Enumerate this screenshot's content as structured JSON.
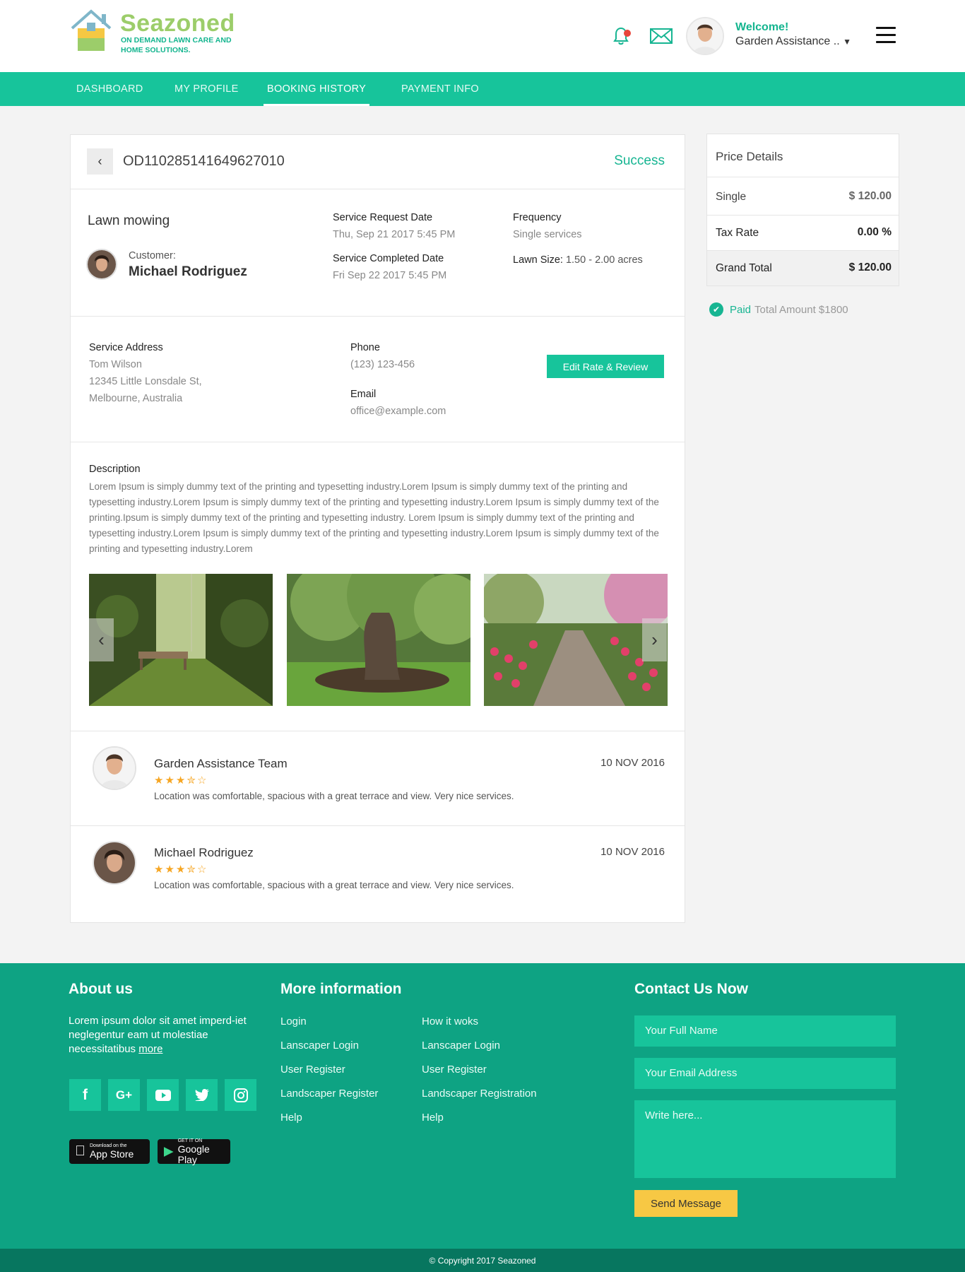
{
  "brand": {
    "name": "Seazoned",
    "tagline": "ON DEMAND LAWN CARE AND HOME SOLUTIONS.",
    "accent": "#17c49b",
    "accent_dark": "#0ea383",
    "logo_green": "#9ccd6a"
  },
  "header": {
    "notification_icon": "bell-icon",
    "message_icon": "envelope-icon",
    "welcome": "Welcome!",
    "user_name": "Garden Assistance ..",
    "dropdown_icon": "caret-down-icon",
    "menu_icon": "hamburger-icon"
  },
  "nav": {
    "items": [
      {
        "label": "DASHBOARD"
      },
      {
        "label": "MY PROFILE"
      },
      {
        "label": "BOOKING HISTORY",
        "active": true
      },
      {
        "label": "PAYMENT INFO"
      }
    ]
  },
  "order": {
    "id": "OD110285141649627010",
    "status": "Success",
    "service": "Lawn mowing",
    "customer_label": "Customer:",
    "customer_name": "Michael Rodriguez",
    "request_date_label": "Service Request Date",
    "request_date": "Thu, Sep 21 2017 5:45 PM",
    "completed_date_label": "Service Completed Date",
    "completed_date": "Fri Sep 22 2017 5:45 PM",
    "frequency_label": "Frequency",
    "frequency": "Single services",
    "lawn_size_label": "Lawn Size:",
    "lawn_size": "1.50 - 2.00 acres"
  },
  "contact": {
    "address_label": "Service Address",
    "address_name": "Tom Wilson",
    "address_line1": "12345 Little Lonsdale St,",
    "address_line2": "Melbourne, Australia",
    "phone_label": "Phone",
    "phone": "(123) 123-456",
    "email_label": "Email",
    "email": "office@example.com",
    "edit_button": "Edit Rate & Review"
  },
  "description": {
    "label": "Description",
    "text": "Lorem Ipsum is simply dummy text of the printing and typesetting industry.Lorem Ipsum is simply dummy text of the printing and typesetting industry.Lorem Ipsum is simply dummy text of the printing and typesetting industry.Lorem Ipsum is simply dummy text of the printing.Ipsum is simply dummy text of the printing and typesetting industry. Lorem Ipsum is simply dummy text of the printing and typesetting industry.Lorem Ipsum is simply dummy text of the printing and typesetting industry.Lorem Ipsum is simply dummy text of the printing and typesetting industry.Lorem"
  },
  "reviews": [
    {
      "name": "Garden Assistance Team",
      "date": "10 NOV 2016",
      "rating": 3.5,
      "text": "Location was comfortable, spacious with a great terrace and view. Very nice services."
    },
    {
      "name": "Michael Rodriguez",
      "date": "10 NOV 2016",
      "rating": 3.5,
      "text": "Location was comfortable, spacious with a great terrace and view. Very nice services."
    }
  ],
  "price": {
    "title": "Price Details",
    "rows": [
      {
        "label": "Single",
        "value": "$ 120.00"
      },
      {
        "label": "Tax Rate",
        "value": "0.00 %"
      },
      {
        "label": "Grand Total",
        "value": "$ 120.00"
      }
    ],
    "paid_label": "Paid",
    "paid_total": "Total Amount $1800"
  },
  "footer": {
    "about_heading": "About us",
    "about_text": "Lorem ipsum dolor sit amet imperd-iet neglegentur eam ut molestiae necessitatibus",
    "about_more": "more",
    "social_icons": [
      "facebook-icon",
      "google-plus-icon",
      "youtube-icon",
      "twitter-icon",
      "instagram-icon"
    ],
    "app_store_small": "Download on the",
    "app_store_big": "App Store",
    "google_play_small": "GET IT ON",
    "google_play_big": "Google Play",
    "more_heading": "More information",
    "links_col1": [
      "Login",
      "Lanscaper Login",
      "User Register",
      "Landscaper Register",
      "Help"
    ],
    "links_col2": [
      "How it woks",
      "Lanscaper Login",
      "User Register",
      "Landscaper Registration",
      "Help"
    ],
    "contact_heading": "Contact Us Now",
    "name_placeholder": "Your Full Name",
    "email_placeholder": "Your Email Address",
    "message_placeholder": "Write here...",
    "send_button": "Send Message",
    "copyright": "© Copyright 2017 Seazoned"
  }
}
